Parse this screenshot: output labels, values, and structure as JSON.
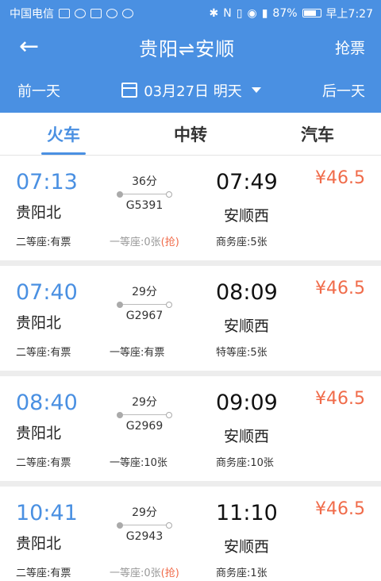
{
  "status_bar": {
    "carrier": "中国电信",
    "battery": "87%",
    "time": "早上7:27"
  },
  "header": {
    "title": "贵阳⇌安顺",
    "grab_label": "抢票"
  },
  "date_bar": {
    "prev_label": "前一天",
    "date": "03月27日 明天",
    "next_label": "后一天"
  },
  "tabs": [
    {
      "label": "火车",
      "active": true
    },
    {
      "label": "中转",
      "active": false
    },
    {
      "label": "汽车",
      "active": false
    }
  ],
  "trains": [
    {
      "dep_time": "07:13",
      "dep_station": "贵阳北",
      "duration": "36分",
      "train_no": "G5391",
      "arr_time": "07:49",
      "arr_station": "安顺西",
      "price": "¥46.5",
      "seats": [
        {
          "text": "二等座:有票",
          "extra": "",
          "dim": false
        },
        {
          "text": "一等座:0张",
          "extra": "(抢)",
          "dim": true
        },
        {
          "text": "商务座:5张",
          "extra": "",
          "dim": false
        }
      ]
    },
    {
      "dep_time": "07:40",
      "dep_station": "贵阳北",
      "duration": "29分",
      "train_no": "G2967",
      "arr_time": "08:09",
      "arr_station": "安顺西",
      "price": "¥46.5",
      "seats": [
        {
          "text": "二等座:有票",
          "extra": "",
          "dim": false
        },
        {
          "text": "一等座:有票",
          "extra": "",
          "dim": false
        },
        {
          "text": "特等座:5张",
          "extra": "",
          "dim": false
        }
      ]
    },
    {
      "dep_time": "08:40",
      "dep_station": "贵阳北",
      "duration": "29分",
      "train_no": "G2969",
      "arr_time": "09:09",
      "arr_station": "安顺西",
      "price": "¥46.5",
      "seats": [
        {
          "text": "二等座:有票",
          "extra": "",
          "dim": false
        },
        {
          "text": "一等座:10张",
          "extra": "",
          "dim": false
        },
        {
          "text": "商务座:10张",
          "extra": "",
          "dim": false
        }
      ]
    },
    {
      "dep_time": "10:41",
      "dep_station": "贵阳北",
      "duration": "29分",
      "train_no": "G2943",
      "arr_time": "11:10",
      "arr_station": "安顺西",
      "price": "¥46.5",
      "seats": [
        {
          "text": "二等座:有票",
          "extra": "",
          "dim": false
        },
        {
          "text": "一等座:0张",
          "extra": "(抢)",
          "dim": true
        },
        {
          "text": "商务座:1张",
          "extra": "",
          "dim": false
        }
      ]
    }
  ]
}
